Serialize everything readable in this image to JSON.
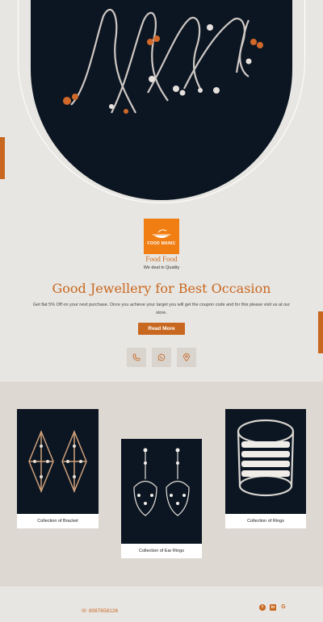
{
  "brand": {
    "logo_text": "FOOD MANIC",
    "name": "Food Food",
    "tagline": "We deal in Quality"
  },
  "hero": {
    "headline": "Good Jewellery for Best Occasion",
    "description": "Get flat 5% Off on your next purchase. Once you achieve your target you will get the coupon code and for this please visit us at our store.",
    "cta_label": "Read More"
  },
  "contact_icons": [
    "phone-icon",
    "whatsapp-icon",
    "location-icon"
  ],
  "collections": [
    {
      "caption": "Collection of Bracket"
    },
    {
      "caption": "Collection of Ear Rings"
    },
    {
      "caption": "Collection of Rings"
    }
  ],
  "footer": {
    "phone": "8087658126",
    "social_icons": [
      "facebook-icon",
      "linkedin-icon",
      "google-icon"
    ],
    "social_letters": [
      "f",
      "in",
      "G"
    ]
  },
  "colors": {
    "accent": "#c8671f",
    "logo_bg": "#f07e12",
    "dark": "#0b1622",
    "page_bg": "#e8e6e2",
    "section_bg": "#ded8d2"
  }
}
